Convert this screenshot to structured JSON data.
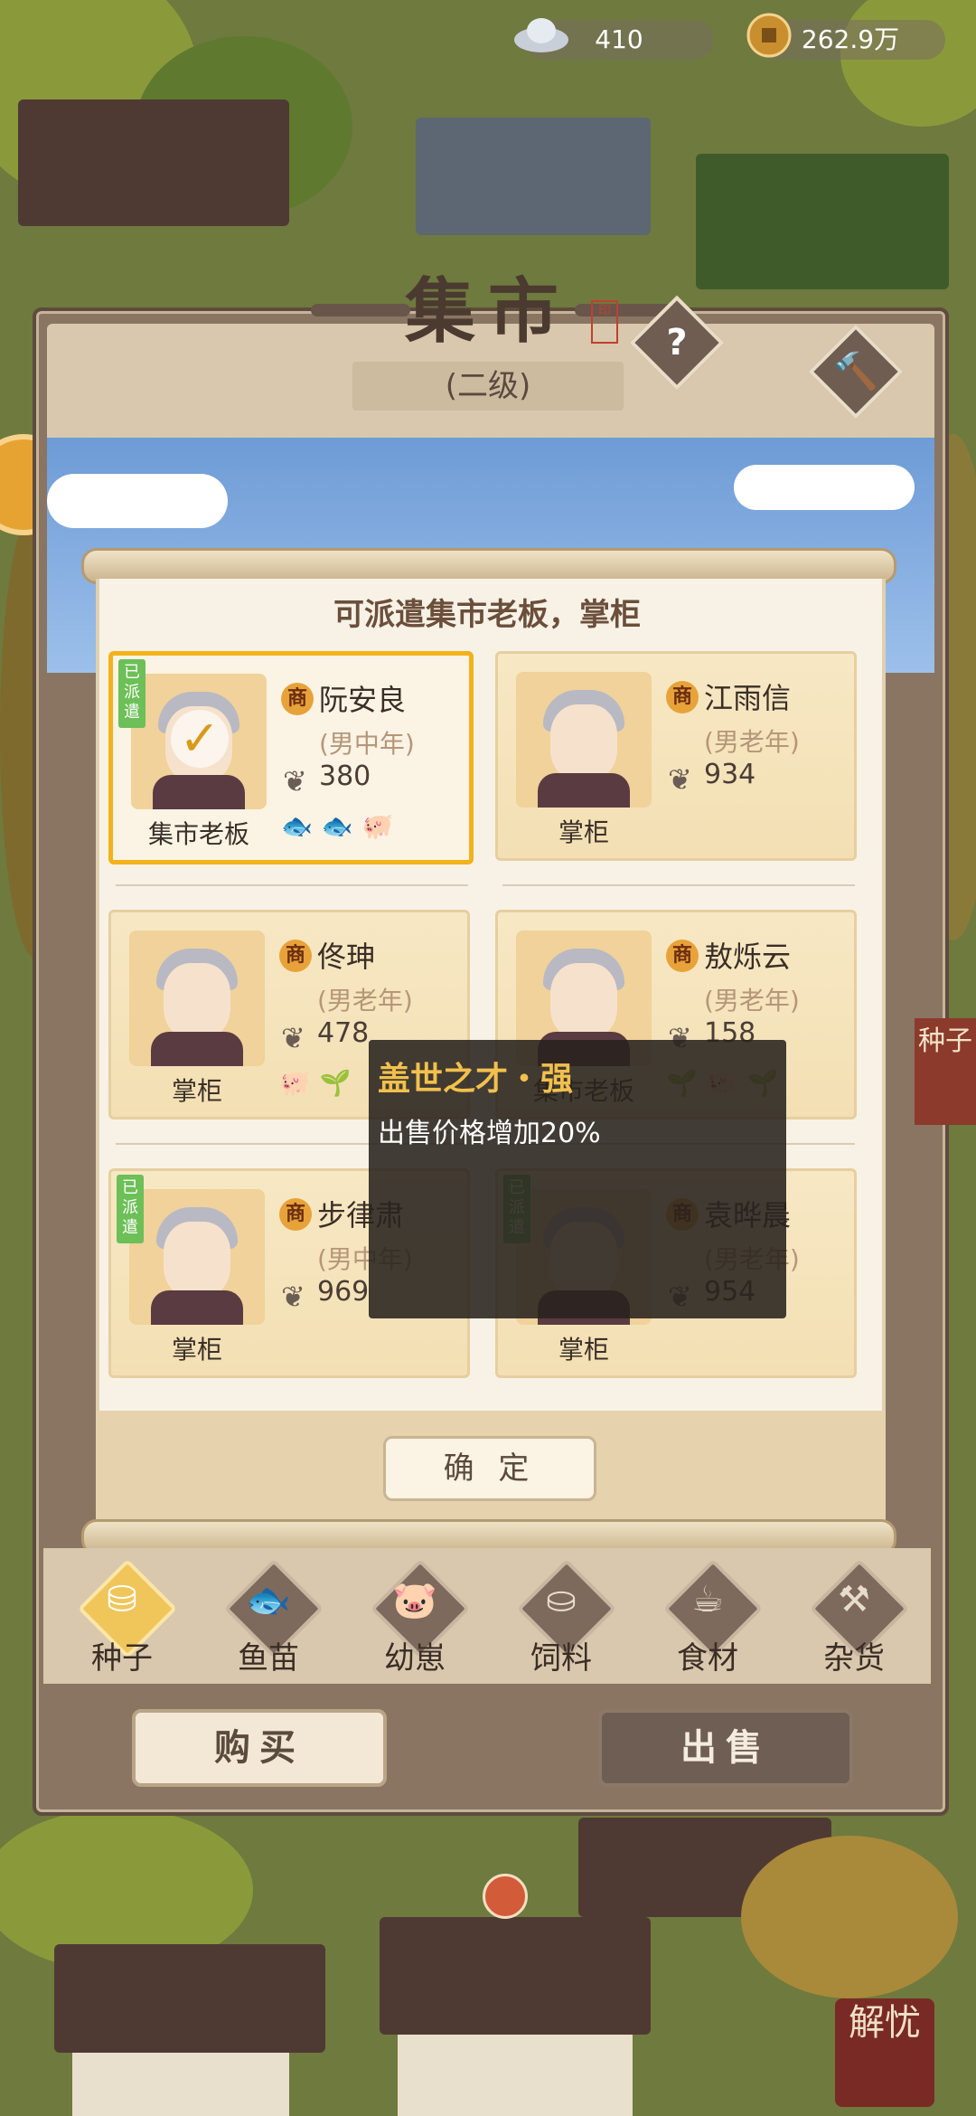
{
  "resources": {
    "silver": "410",
    "coins": "262.9万"
  },
  "panel": {
    "title": "集市",
    "level": "(二级)",
    "help_icon": "question-icon",
    "hammer_icon": "hammer-icon"
  },
  "dialog": {
    "title": "可派遣集市老板，掌柜",
    "confirm": "确 定",
    "dispatched_tag": "已派遣"
  },
  "characters": [
    {
      "badge": "商",
      "name": "阮安良",
      "age": "(男中年)",
      "score": "380",
      "role": "集市老板",
      "dispatched": true,
      "selected": true
    },
    {
      "badge": "商",
      "name": "江雨信",
      "age": "(男老年)",
      "score": "934",
      "role": "掌柜",
      "dispatched": false,
      "selected": false
    },
    {
      "badge": "商",
      "name": "佟珅",
      "age": "(男老年)",
      "score": "478",
      "role": "掌柜",
      "dispatched": false,
      "selected": false
    },
    {
      "badge": "商",
      "name": "敖烁云",
      "age": "(男老年)",
      "score": "158",
      "role": "集市老板",
      "dispatched": false,
      "selected": false
    },
    {
      "badge": "商",
      "name": "步律肃",
      "age": "(男中年)",
      "score": "969",
      "role": "掌柜",
      "dispatched": true,
      "selected": false
    },
    {
      "badge": "商",
      "name": "袁晔晨",
      "age": "(男老年)",
      "score": "954",
      "role": "掌柜",
      "dispatched": true,
      "selected": false
    }
  ],
  "tooltip": {
    "title": "盖世之才・强",
    "description": "出售价格增加20%"
  },
  "tabs": [
    {
      "label": "种子",
      "icon": "seed-bag-icon",
      "active": true
    },
    {
      "label": "鱼苗",
      "icon": "fish-icon",
      "active": false
    },
    {
      "label": "幼崽",
      "icon": "piglet-icon",
      "active": false
    },
    {
      "label": "饲料",
      "icon": "feed-sack-icon",
      "active": false
    },
    {
      "label": "食材",
      "icon": "teapot-icon",
      "active": false
    },
    {
      "label": "杂货",
      "icon": "hammer-icon",
      "active": false
    }
  ],
  "actions": {
    "buy": "购买",
    "sell": "出售"
  },
  "side": {
    "right_tag": "种子",
    "corner_seal": "解忧"
  },
  "colors": {
    "accent_gold": "#f2b21b",
    "dispatched_green": "#6dbf58",
    "tooltip_title": "#f2c04d"
  }
}
